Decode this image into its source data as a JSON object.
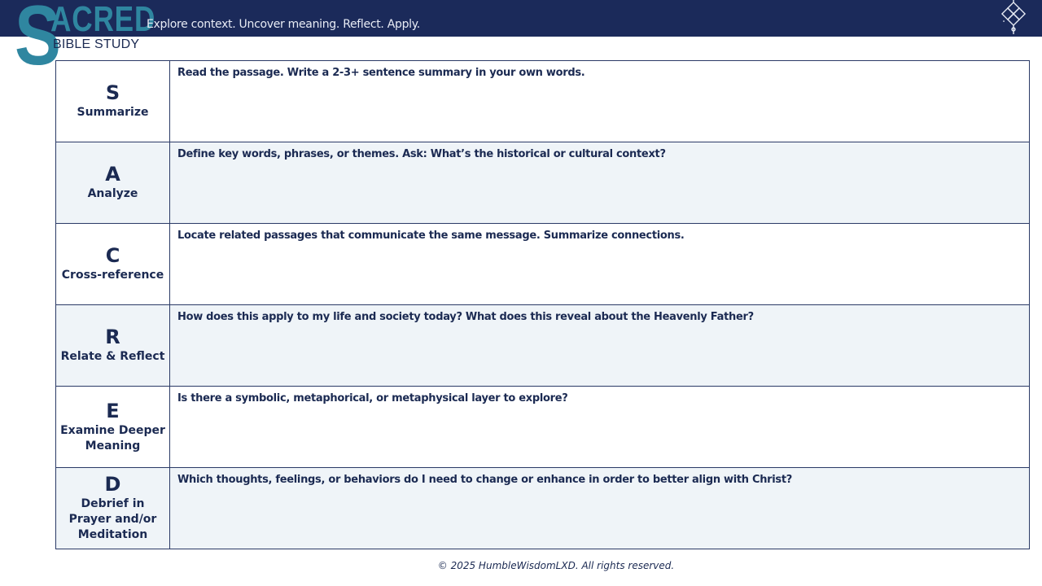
{
  "header": {
    "logo_initial": "S",
    "logo_rest": "ACRED",
    "logo_sub": "BIBLE STUDY",
    "tagline": "Explore context. Uncover meaning. Reflect. Apply.",
    "ornament_icon": "celtic-knot-icon",
    "bar_color": "#1b2a5a",
    "logo_color": "#2f86a0"
  },
  "rows": [
    {
      "letter": "S",
      "label": "Summarize",
      "prompt": "Read the passage. Write a 2-3+ sentence summary in your own words."
    },
    {
      "letter": "A",
      "label": "Analyze",
      "prompt": "Define key words, phrases, or themes. Ask: What’s the historical or cultural context?"
    },
    {
      "letter": "C",
      "label": "Cross-reference",
      "prompt": "Locate related passages that communicate the same message. Summarize connections."
    },
    {
      "letter": "R",
      "label": "Relate & Reflect",
      "prompt": "How does this apply to my life and society today? What does this reveal about the Heavenly Father?"
    },
    {
      "letter": "E",
      "label": "Examine Deeper Meaning",
      "prompt": "Is there a symbolic, metaphorical, or metaphysical layer to explore?"
    },
    {
      "letter": "D",
      "label": "Debrief in Prayer and/or Meditation",
      "prompt": "Which thoughts, feelings, or behaviors do I need to change or enhance in order to better align with Christ?"
    }
  ],
  "footer": {
    "copyright": "© 2025 HumbleWisdomLXD. All rights reserved."
  }
}
